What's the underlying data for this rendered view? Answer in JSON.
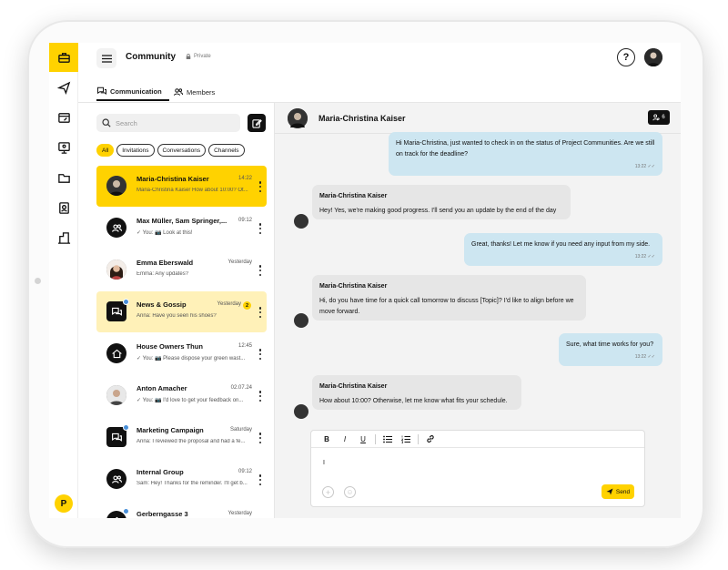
{
  "header": {
    "title": "Community",
    "privacy": "Private",
    "help_icon": "question-circle-icon"
  },
  "tabs": [
    {
      "label": "Communication",
      "icon": "chat-bubbles-icon",
      "active": true
    },
    {
      "label": "Members",
      "icon": "people-icon",
      "active": false
    }
  ],
  "rail": {
    "items": [
      "briefcase-icon",
      "send-icon",
      "edit-board-icon",
      "presentation-icon",
      "folder-icon",
      "contacts-icon",
      "building-icon"
    ],
    "active_index": 0,
    "logo": "P"
  },
  "search": {
    "placeholder": "Search"
  },
  "filters": [
    "All",
    "Invitations",
    "Conversations",
    "Channels"
  ],
  "active_filter": "All",
  "conversations": [
    {
      "name": "Maria-Christina Kaiser",
      "time": "14:22",
      "snippet": "Maria-Christina Kaiser  How about 10:00? Ot..."
    },
    {
      "name": "Max Müller, Sam Springer,...",
      "time": "09:12",
      "snippet": "✓ You:  📷 Look at this!"
    },
    {
      "name": "Emma Eberswald",
      "time": "Yesterday",
      "snippet": "Emma:  Any updates?"
    },
    {
      "name": "News & Gossip",
      "time": "Yesterday",
      "snippet": "Anna:  Have you seen his shoes?",
      "unread": "2"
    },
    {
      "name": "House Owners Thun",
      "time": "12:45",
      "snippet": "✓ You:  📷 Please dispose your green wast..."
    },
    {
      "name": "Anton Amacher",
      "time": "02.07.24",
      "snippet": "✓ You:  📷 I'd love to get your feedback on..."
    },
    {
      "name": "Marketing Campaign",
      "time": "Saturday",
      "snippet": "Anna:  I reviewed the proposal and had a fe..."
    },
    {
      "name": "Internal Group",
      "time": "09:12",
      "snippet": "Sam:  Hey! Thanks for the reminder. I'll get b..."
    },
    {
      "name": "Gerberngasse 3",
      "time": "Yesterday",
      "snippet": ""
    }
  ],
  "chat": {
    "title": "Maria-Christina Kaiser",
    "member_count": "6",
    "messages": [
      {
        "direction": "out",
        "text": "Hi Maria-Christina, just wanted to check in on the status of Project Communities. Are we still on track for the deadline?",
        "time": "13:22"
      },
      {
        "direction": "in",
        "sender": "Maria-Christina Kaiser",
        "text": "Hey! Yes, we're making good progress. I'll send you an update by the end of the day"
      },
      {
        "direction": "out",
        "text": "Great, thanks! Let me know if you need any input from my side.",
        "time": "13:22"
      },
      {
        "direction": "in",
        "sender": "Maria-Christina Kaiser",
        "text": "Hi, do you have time for a quick call tomorrow to discuss [Topic]? I'd like to align before we move forward."
      },
      {
        "direction": "out",
        "text": "Sure, what time works for you?",
        "time": "13:22"
      },
      {
        "direction": "in",
        "sender": "Maria-Christina Kaiser",
        "text": "How about 10:00? Otherwise, let me know what fits your schedule."
      }
    ]
  },
  "composer": {
    "text": "I",
    "toolbar": [
      "B",
      "I",
      "U",
      "bullet-list-icon",
      "numbered-list-icon",
      "link-icon"
    ],
    "send_label": "Send"
  },
  "colors": {
    "accent": "#ffd200",
    "outgoing_bubble": "#cde6f1",
    "incoming_bubble": "#e6e6e6"
  }
}
